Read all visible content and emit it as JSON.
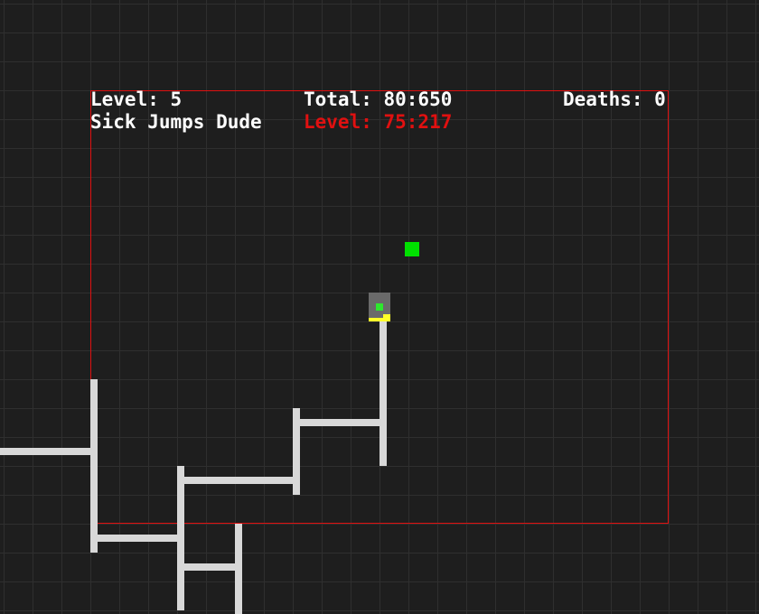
{
  "hud": {
    "level_label": "Level: 5",
    "level_name": "Sick Jumps Dude",
    "total_time": "Total: 80:650",
    "level_time": "Level: 75:217",
    "deaths": "Deaths: 0"
  },
  "colors": {
    "background": "#1e1e1e",
    "grid": "#2f2f2f",
    "hud_text": "#ffffff",
    "level_timer_text": "#e01010",
    "level_border": "#e01010",
    "wall": "#d8d8d8",
    "goal": "#00e000",
    "player_body": "#6a6a6a",
    "player_eye": "#2ee82e",
    "player_feet": "#ffff2a"
  },
  "icons": {
    "goal": "green-square-goal-icon",
    "player": "player-block-icon"
  }
}
